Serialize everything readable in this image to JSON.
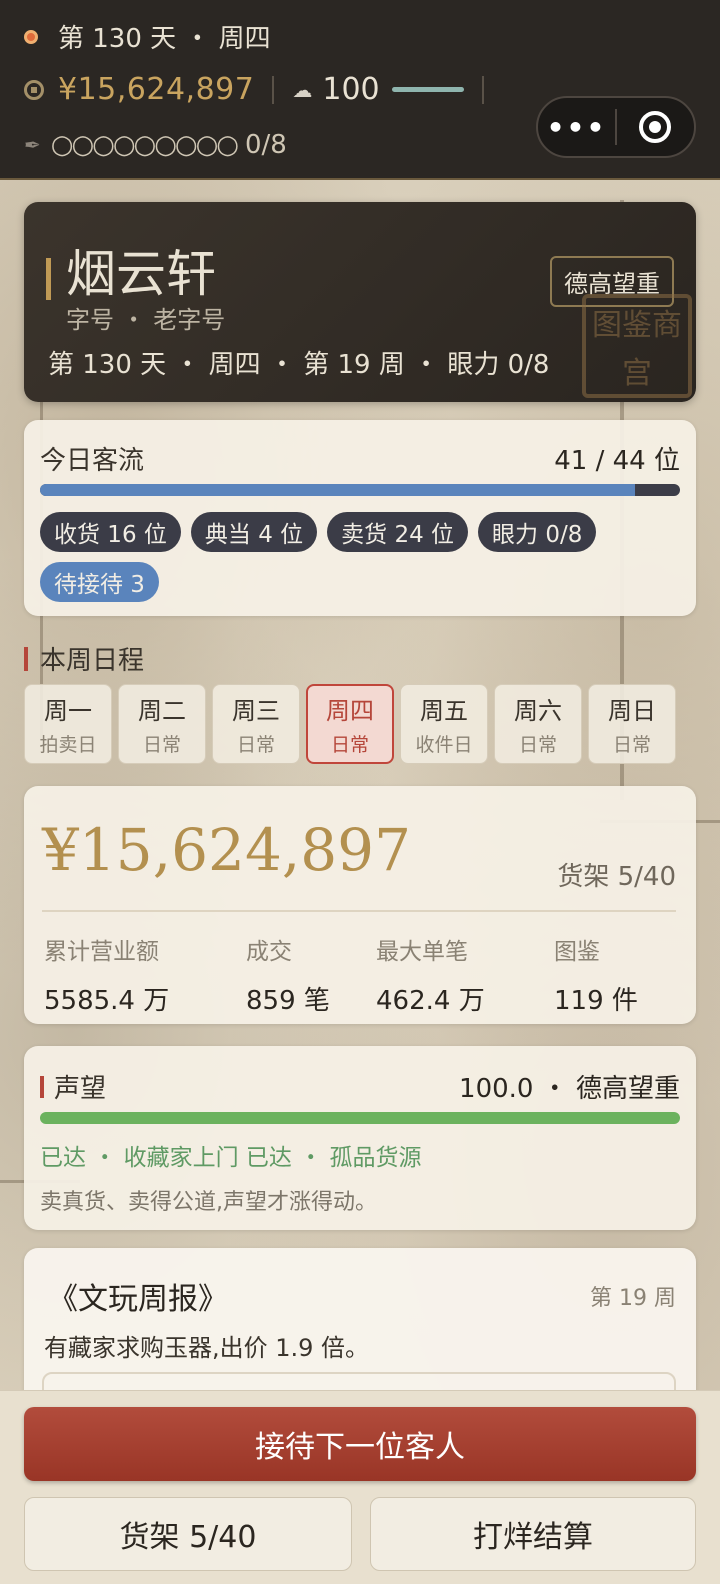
{
  "status": {
    "day_line": "第 130 天 ・ 周四",
    "money": "¥15,624,897",
    "reputation": "100",
    "eye_slots": "○○○○○○○○○",
    "eye_count": "0/8"
  },
  "shop": {
    "name": "烟云轩",
    "subtitle": "字号 ・ 老字号",
    "badge": "德高望重",
    "info": "第 130 天 ・ 周四 ・ 第 19 周 ・ 眼力 0/8",
    "seal_text": "图鉴商宫"
  },
  "traffic": {
    "title": "今日客流",
    "count": "41 / 44 位",
    "progress": 0.93,
    "chips": [
      "收货 16 位",
      "典当 4 位",
      "卖货 24 位",
      "眼力 0/8"
    ],
    "pending": "待接待 3"
  },
  "week": {
    "title": "本周日程",
    "days": [
      {
        "day": "周一",
        "type": "拍卖日"
      },
      {
        "day": "周二",
        "type": "日常"
      },
      {
        "day": "周三",
        "type": "日常"
      },
      {
        "day": "周四",
        "type": "日常"
      },
      {
        "day": "周五",
        "type": "收件日"
      },
      {
        "day": "周六",
        "type": "日常"
      },
      {
        "day": "周日",
        "type": "日常"
      }
    ],
    "active_index": 3
  },
  "finance": {
    "money": "¥15,624,897",
    "shelf": "货架 5/40",
    "stats": [
      {
        "label": "累计营业额",
        "value": "5585.4 万"
      },
      {
        "label": "成交",
        "value": "859 笔"
      },
      {
        "label": "最大单笔",
        "value": "462.4 万"
      },
      {
        "label": "图鉴",
        "value": "119 件"
      }
    ]
  },
  "reputation": {
    "title": "声望",
    "value": "100.0 ・ 德高望重",
    "progress": 1.0,
    "unlocks": "已达 ・ 收藏家上门   已达 ・ 孤品货源",
    "desc": "卖真货、卖得公道,声望才涨得动。"
  },
  "news": {
    "title": "《文玩周报》",
    "week": "第 19 周",
    "body": "有藏家求购玉器,出价 1.9 倍。"
  },
  "actions": {
    "primary": "接待下一位客人",
    "shelf": "货架 5/40",
    "settle": "打烊结算"
  },
  "colors": {
    "accent_gold": "#b3904f",
    "primary_red": "#a43f2f",
    "traffic_blue": "#5a84bc",
    "rep_green": "#6bb25e"
  }
}
